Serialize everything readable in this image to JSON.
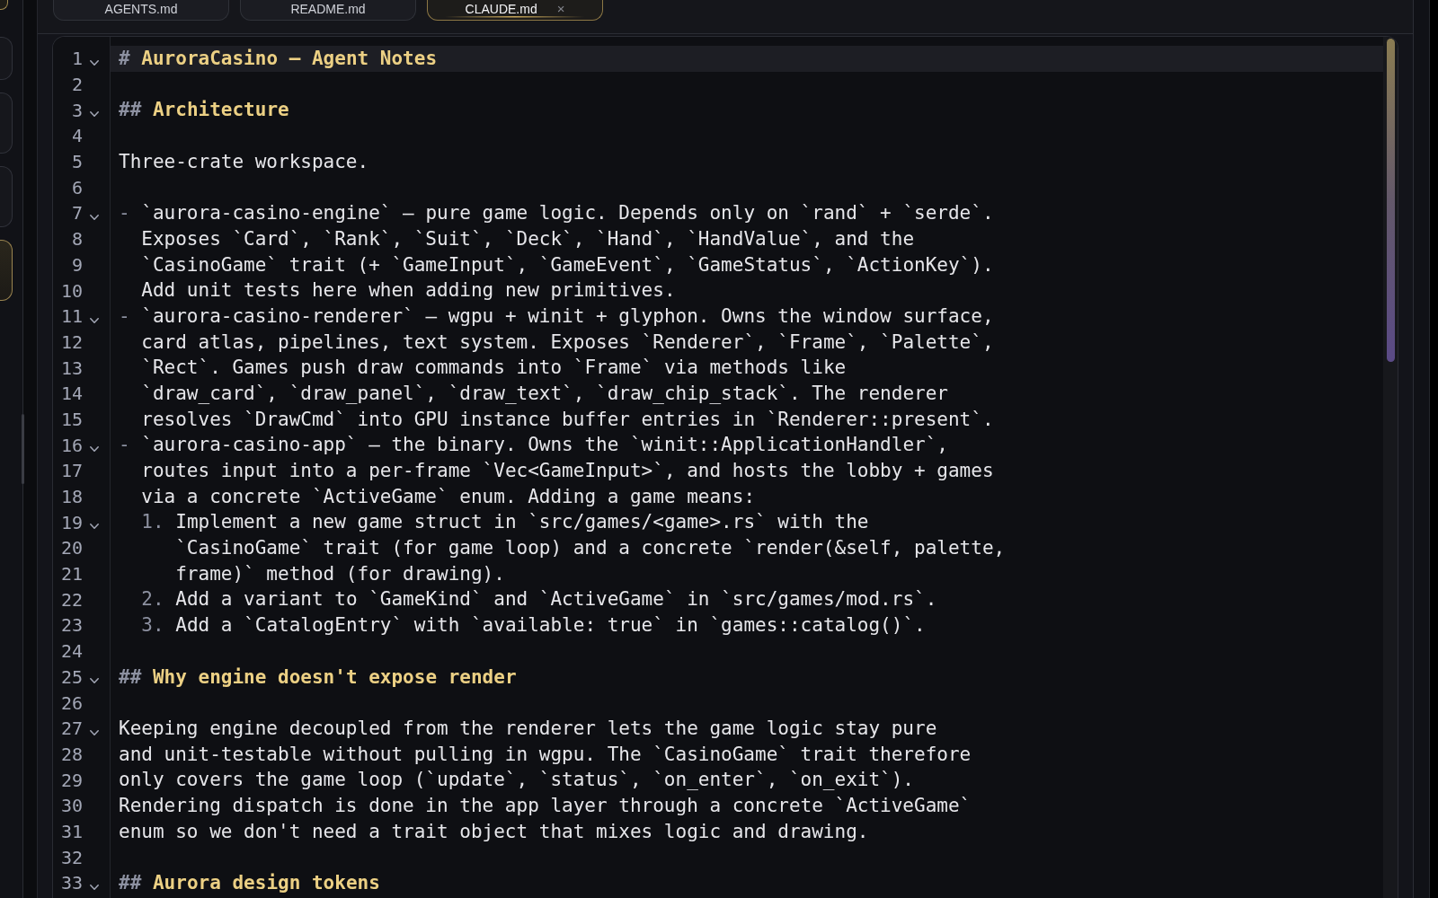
{
  "tabs": [
    {
      "label": "AGENTS.md",
      "selected": false
    },
    {
      "label": "README.md",
      "selected": false
    },
    {
      "label": "CLAUDE.md",
      "selected": true,
      "close": "×"
    }
  ],
  "sidebar": {
    "items": [
      {
        "selected": false
      },
      {
        "selected": false
      },
      {
        "selected": false
      },
      {
        "selected": true
      }
    ]
  },
  "editor": {
    "lines": [
      {
        "number": "1",
        "kind": "heading",
        "marker": "#",
        "text": "AuroraCasino — Agent Notes",
        "foldable": true,
        "current": true
      },
      {
        "number": "2",
        "kind": "blank",
        "foldable": false,
        "current": false
      },
      {
        "number": "3",
        "kind": "heading",
        "marker": "##",
        "text": "Architecture",
        "foldable": true,
        "current": false
      },
      {
        "number": "4",
        "kind": "blank",
        "foldable": false,
        "current": false
      },
      {
        "number": "5",
        "kind": "text",
        "text": "Three-crate workspace.",
        "foldable": false,
        "current": false
      },
      {
        "number": "6",
        "kind": "blank",
        "foldable": false,
        "current": false
      },
      {
        "number": "7",
        "kind": "list",
        "marker": "-",
        "text": "`aurora-casino-engine` — pure game logic. Depends only on `rand` + `serde`.",
        "foldable": true,
        "current": false
      },
      {
        "number": "8",
        "kind": "text",
        "text": "  Exposes `Card`, `Rank`, `Suit`, `Deck`, `Hand`, `HandValue`, and the",
        "foldable": false,
        "current": false
      },
      {
        "number": "9",
        "kind": "text",
        "text": "  `CasinoGame` trait (+ `GameInput`, `GameEvent`, `GameStatus`, `ActionKey`).",
        "foldable": false,
        "current": false
      },
      {
        "number": "10",
        "kind": "text",
        "text": "  Add unit tests here when adding new primitives.",
        "foldable": false,
        "current": false
      },
      {
        "number": "11",
        "kind": "list",
        "marker": "-",
        "text": "`aurora-casino-renderer` — wgpu + winit + glyphon. Owns the window surface,",
        "foldable": true,
        "current": false
      },
      {
        "number": "12",
        "kind": "text",
        "text": "  card atlas, pipelines, text system. Exposes `Renderer`, `Frame`, `Palette`,",
        "foldable": false,
        "current": false
      },
      {
        "number": "13",
        "kind": "text",
        "text": "  `Rect`. Games push draw commands into `Frame` via methods like",
        "foldable": false,
        "current": false
      },
      {
        "number": "14",
        "kind": "text",
        "text": "  `draw_card`, `draw_panel`, `draw_text`, `draw_chip_stack`. The renderer",
        "foldable": false,
        "current": false
      },
      {
        "number": "15",
        "kind": "text",
        "text": "  resolves `DrawCmd` into GPU instance buffer entries in `Renderer::present`.",
        "foldable": false,
        "current": false
      },
      {
        "number": "16",
        "kind": "list",
        "marker": "-",
        "text": "`aurora-casino-app` — the binary. Owns the `winit::ApplicationHandler`,",
        "foldable": true,
        "current": false
      },
      {
        "number": "17",
        "kind": "text",
        "text": "  routes input into a per-frame `Vec<GameInput>`, and hosts the lobby + games",
        "foldable": false,
        "current": false
      },
      {
        "number": "18",
        "kind": "text",
        "text": "  via a concrete `ActiveGame` enum. Adding a game means:",
        "foldable": false,
        "current": false
      },
      {
        "number": "19",
        "kind": "list",
        "marker": "  1.",
        "text": "Implement a new game struct in `src/games/<game>.rs` with the",
        "foldable": true,
        "current": false
      },
      {
        "number": "20",
        "kind": "text",
        "text": "     `CasinoGame` trait (for game loop) and a concrete `render(&self, palette,",
        "foldable": false,
        "current": false
      },
      {
        "number": "21",
        "kind": "text",
        "text": "     frame)` method (for drawing).",
        "foldable": false,
        "current": false
      },
      {
        "number": "22",
        "kind": "list",
        "marker": "  2.",
        "text": "Add a variant to `GameKind` and `ActiveGame` in `src/games/mod.rs`.",
        "foldable": false,
        "current": false
      },
      {
        "number": "23",
        "kind": "list",
        "marker": "  3.",
        "text": "Add a `CatalogEntry` with `available: true` in `games::catalog()`.",
        "foldable": false,
        "current": false
      },
      {
        "number": "24",
        "kind": "blank",
        "foldable": false,
        "current": false
      },
      {
        "number": "25",
        "kind": "heading",
        "marker": "##",
        "text": "Why engine doesn't expose render",
        "foldable": true,
        "current": false
      },
      {
        "number": "26",
        "kind": "blank",
        "foldable": false,
        "current": false
      },
      {
        "number": "27",
        "kind": "text",
        "text": "Keeping engine decoupled from the renderer lets the game logic stay pure",
        "foldable": true,
        "current": false
      },
      {
        "number": "28",
        "kind": "text",
        "text": "and unit-testable without pulling in wgpu. The `CasinoGame` trait therefore",
        "foldable": false,
        "current": false
      },
      {
        "number": "29",
        "kind": "text",
        "text": "only covers the game loop (`update`, `status`, `on_enter`, `on_exit`).",
        "foldable": false,
        "current": false
      },
      {
        "number": "30",
        "kind": "text",
        "text": "Rendering dispatch is done in the app layer through a concrete `ActiveGame`",
        "foldable": false,
        "current": false
      },
      {
        "number": "31",
        "kind": "text",
        "text": "enum so we don't need a trait object that mixes logic and drawing.",
        "foldable": false,
        "current": false
      },
      {
        "number": "32",
        "kind": "blank",
        "foldable": false,
        "current": false
      },
      {
        "number": "33",
        "kind": "heading",
        "marker": "##",
        "text": "Aurora design tokens",
        "foldable": true,
        "current": false
      }
    ]
  }
}
